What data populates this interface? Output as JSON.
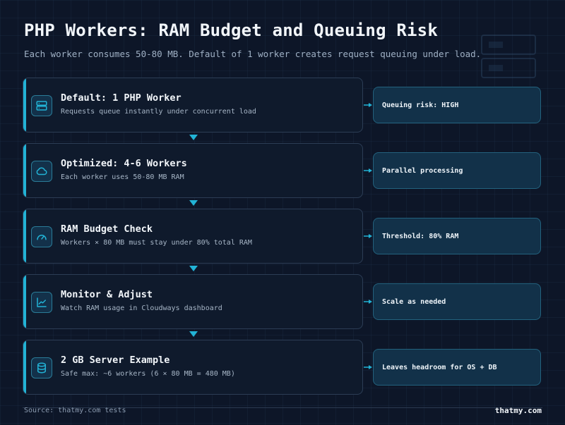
{
  "header": {
    "title": "PHP Workers: RAM Budget and Queuing Risk",
    "subtitle": "Each worker consumes 50-80 MB. Default of 1 worker creates request queuing under load."
  },
  "steps": [
    {
      "title": "Default: 1 PHP Worker",
      "desc": "Requests queue instantly under concurrent load",
      "icon": "server-icon",
      "badge": "Queuing risk: HIGH"
    },
    {
      "title": "Optimized: 4-6 Workers",
      "desc": "Each worker uses 50-80 MB RAM",
      "icon": "cloud-icon",
      "badge": "Parallel processing"
    },
    {
      "title": "RAM Budget Check",
      "desc": "Workers × 80 MB must stay under 80% total RAM",
      "icon": "gauge-icon",
      "badge": "Threshold: 80% RAM"
    },
    {
      "title": "Monitor & Adjust",
      "desc": "Watch RAM usage in Cloudways dashboard",
      "icon": "chart-line-icon",
      "badge": "Scale as needed"
    },
    {
      "title": "2 GB Server Example",
      "desc": "Safe max: ~6 workers (6 × 80 MB = 480 MB)",
      "icon": "database-icon",
      "badge": "Leaves headroom for OS + DB"
    }
  ],
  "footer": {
    "source": "Source: thatmy.com tests",
    "brand": "thatmy.com"
  },
  "colors": {
    "background": "#0d1628",
    "accent": "#22b3d6",
    "card": "#0f1a2c",
    "badge": "#123149"
  }
}
